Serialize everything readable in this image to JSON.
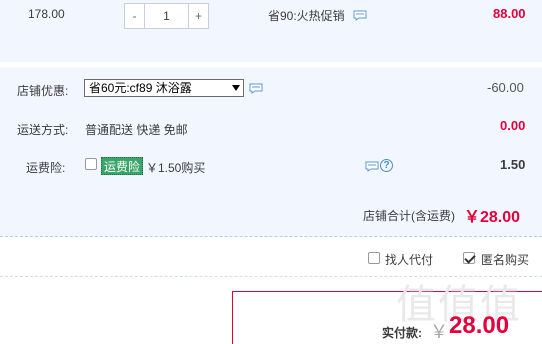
{
  "item": {
    "unit_price": "178.00",
    "qty_minus": "-",
    "qty_value": "1",
    "qty_plus": "+",
    "promo": "省90:火热促销",
    "subtotal": "88.00"
  },
  "discount": {
    "label": "店铺优惠:",
    "selected": "省60元:cf89 沐浴露",
    "amount": "-60.00"
  },
  "shipping": {
    "label": "运送方式:",
    "method": "普通配送 快递 免邮",
    "amount": "0.00"
  },
  "insurance": {
    "label": "运费险:",
    "badge": "运费险",
    "price": "￥1.50购买",
    "help": "?",
    "amount": "1.50"
  },
  "shop_total": {
    "label": "店铺合计(含运费)",
    "amount": "￥28.00"
  },
  "options": {
    "proxy_pay": "找人代付",
    "anonymous": "匿名购买",
    "anonymous_checked": true
  },
  "payment": {
    "label": "实付款:",
    "currency": "￥",
    "amount": "28.00"
  },
  "colors": {
    "accent": "#e4003a",
    "band_bg": "#f2f7ff",
    "badge_bg": "#3aa56b"
  }
}
